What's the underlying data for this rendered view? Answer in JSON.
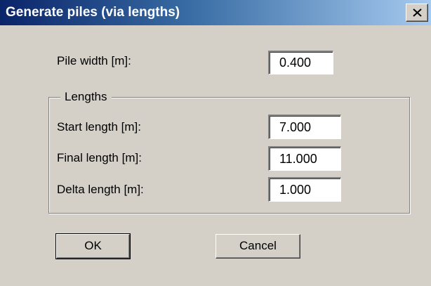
{
  "dialog": {
    "title": "Generate piles (via lengths)",
    "close_glyph": "X",
    "colors": {
      "face": "#d4d0c8",
      "title_start": "#0a246a",
      "title_end": "#a6caf0",
      "title_text": "#ffffff"
    }
  },
  "pile_width": {
    "label": "Pile width [m]:",
    "value": "0.400"
  },
  "lengths_group": {
    "legend": "Lengths",
    "start": {
      "label": "Start length [m]:",
      "value": "7.000"
    },
    "final": {
      "label": "Final length [m]:",
      "value": "11.000"
    },
    "delta": {
      "label": "Delta length [m]:",
      "value": "1.000"
    }
  },
  "buttons": {
    "ok": "OK",
    "cancel": "Cancel"
  },
  "icons": {
    "close": "close-icon"
  }
}
